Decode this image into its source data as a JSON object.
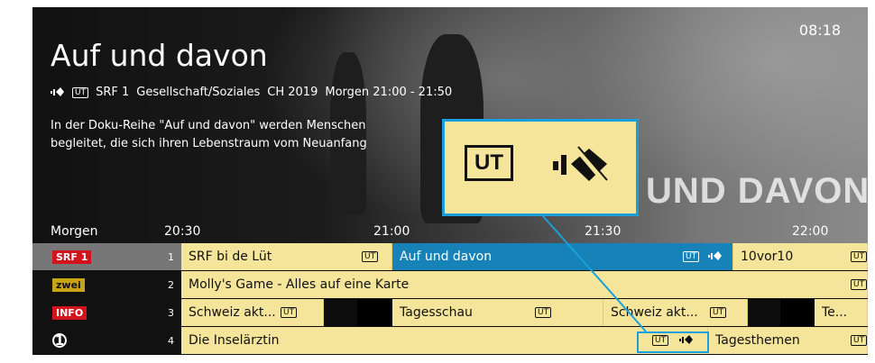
{
  "header": {
    "title": "Auf und davon",
    "clock": "08:18",
    "channel": "SRF 1",
    "genre": "Gesellschaft/Soziales",
    "country_year": "CH 2019",
    "airtime": "Morgen 21:00 - 21:50",
    "ut_badge": "UT",
    "description_line1": "In der Doku-Reihe \"Auf und davon\" werden Menschen",
    "description_line2": "begleitet, die sich ihren Lebenstraum vom Neuanfang",
    "watermark": "UND DAVON I"
  },
  "timeline": {
    "day": "Morgen",
    "times": [
      "20:30",
      "21:00",
      "21:30",
      "22:00"
    ]
  },
  "zoom": {
    "ut_label": "UT"
  },
  "channels": [
    {
      "logo": "SRF 1",
      "number": "1"
    },
    {
      "logo": "zwei",
      "number": "2"
    },
    {
      "logo": "INFO",
      "number": "3"
    },
    {
      "logo": "1",
      "number": "4"
    }
  ],
  "rows": [
    {
      "programs": [
        {
          "title": "SRF bi de Lüt",
          "ut": "UT"
        },
        {
          "title": "Auf und davon",
          "ut": "UT"
        },
        {
          "title": "10vor10",
          "ut": "UT"
        }
      ]
    },
    {
      "programs": [
        {
          "title": "Molly's Game - Alles auf eine Karte",
          "ut": "UT"
        }
      ]
    },
    {
      "programs": [
        {
          "title": "Schweiz akt...",
          "ut": "UT"
        },
        {
          "title": "Tagesschau",
          "ut": "UT"
        },
        {
          "title": "Schweiz akt...",
          "ut": "UT"
        },
        {
          "title": "Te..."
        }
      ]
    },
    {
      "programs": [
        {
          "title": "Die Inselärztin",
          "ut": "UT"
        },
        {
          "title": "Tagesthemen",
          "ut": "UT"
        }
      ]
    }
  ],
  "colors": {
    "accent": "#1682b8",
    "program_bg": "#f4e59a",
    "highlight": "#19a0dc"
  }
}
